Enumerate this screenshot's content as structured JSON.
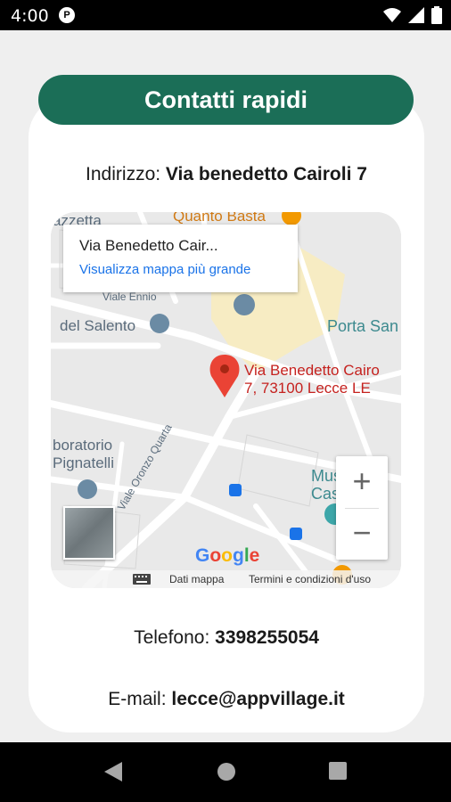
{
  "status_bar": {
    "time": "4:00",
    "app_icon": "P",
    "icons": [
      "wifi-icon",
      "signal-icon",
      "battery-icon"
    ]
  },
  "header": {
    "title": "Contatti rapidi"
  },
  "address": {
    "label": "Indirizzo:",
    "value": "Via benedetto Cairoli 7"
  },
  "map": {
    "popup_title": "Via Benedetto Cair...",
    "popup_link": "Visualizza mappa più grande",
    "pin_label_line1": "Via Benedetto Cairo",
    "pin_label_line2": "7, 73100 Lecce LE",
    "labels": {
      "gazzetta": "azzetta",
      "quanto_basta": "Quanto Basta",
      "viale_ennio": "Viale Ennio",
      "del_salento": "del Salento",
      "porta_san": "Porta San",
      "laboratorio": "boratorio",
      "pignatelli": "Pignatelli",
      "viale_oronzo": "Viale Oronzo Quarta",
      "museo": "Museo",
      "castello": "Cas"
    },
    "google_logo": [
      "G",
      "o",
      "o",
      "g",
      "l",
      "e"
    ],
    "footer": {
      "dati_mappa": "Dati mappa",
      "termini": "Termini e condizioni d'uso"
    },
    "zoom_in": "+",
    "zoom_out": "−",
    "colors": {
      "pin": "#ea4335",
      "road": "#ffffff",
      "yellow_zone": "#f7ecc3"
    }
  },
  "phone": {
    "label": "Telefono:",
    "value": "3398255054"
  },
  "email": {
    "label": "E-mail:",
    "value": "lecce@appvillage.it"
  },
  "colors": {
    "accent": "#1b6e57",
    "card": "#ffffff",
    "background": "#efefef"
  }
}
